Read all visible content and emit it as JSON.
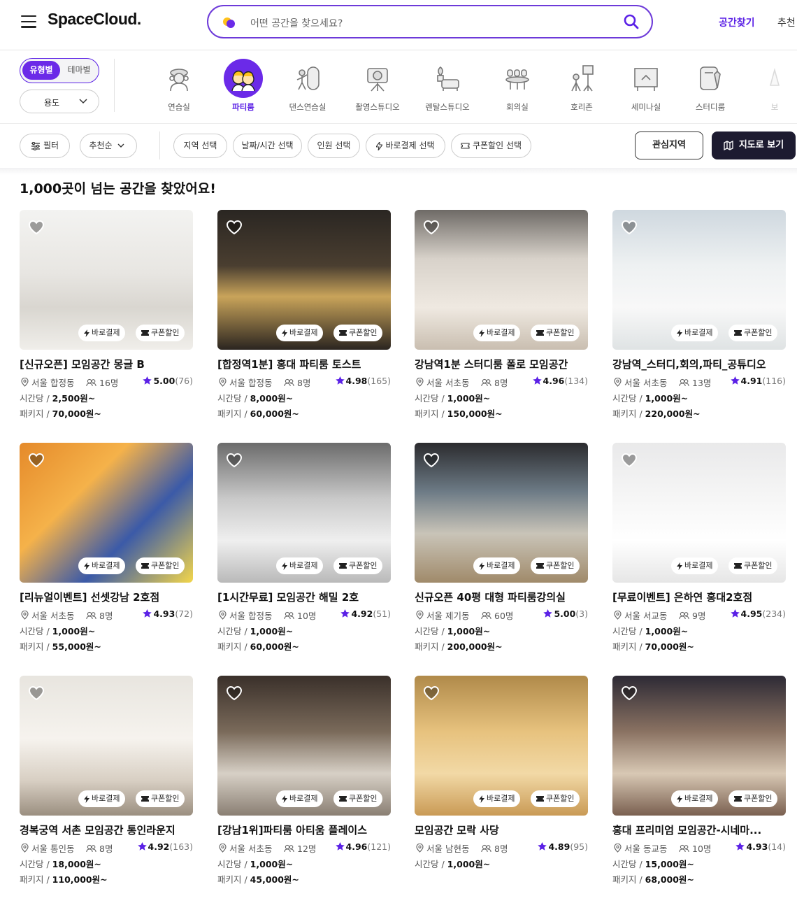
{
  "header": {
    "logo": "SpaceCloud.",
    "search_placeholder": "어떤 공간을 찾으세요?",
    "nav_find": "공간찾기",
    "nav_recommend": "추천"
  },
  "type_toggle": {
    "type": "유형별",
    "theme": "테마별",
    "usage": "용도"
  },
  "categories": [
    {
      "label": "연습실",
      "icon": "practice-room-icon"
    },
    {
      "label": "파티룸",
      "icon": "party-room-icon",
      "active": true
    },
    {
      "label": "댄스연습실",
      "icon": "dance-room-icon"
    },
    {
      "label": "촬영스튜디오",
      "icon": "camera-studio-icon"
    },
    {
      "label": "렌탈스튜디오",
      "icon": "rental-studio-icon"
    },
    {
      "label": "회의실",
      "icon": "meeting-room-icon"
    },
    {
      "label": "호리존",
      "icon": "horizon-icon"
    },
    {
      "label": "세미나실",
      "icon": "seminar-room-icon"
    },
    {
      "label": "스터디룸",
      "icon": "study-room-icon"
    },
    {
      "label": "보",
      "icon": "more-icon"
    }
  ],
  "filters": {
    "filter": "필터",
    "sort": "추천순",
    "region": "지역 선택",
    "datetime": "날짜/시간 선택",
    "people": "인원 선택",
    "instant": "바로결제 선택",
    "coupon": "쿠폰할인 선택",
    "interest": "관심지역",
    "map": "지도로 보기"
  },
  "result_title": "1,000곳이 넘는 공간을 찾았어요!",
  "badges": {
    "instant": "바로결제",
    "coupon": "쿠폰할인"
  },
  "price_labels": {
    "hour": "시간당 /",
    "package": "패키지 /"
  },
  "listings": [
    {
      "title": "[신규오픈] 모임공간 몽글 B",
      "location": "서울 합정동",
      "capacity": "16명",
      "rating": "5.00",
      "reviews": "(76)",
      "hourly": "2,500원~",
      "package": "70,000원~"
    },
    {
      "title": "[합정역1분] 홍대 파티룸 토스트",
      "location": "서울 합정동",
      "capacity": "8명",
      "rating": "4.98",
      "reviews": "(165)",
      "hourly": "8,000원~",
      "package": "60,000원~"
    },
    {
      "title": "강남역1분 스터디룸 폴로 모임공간",
      "location": "서울 서초동",
      "capacity": "8명",
      "rating": "4.96",
      "reviews": "(134)",
      "hourly": "1,000원~",
      "package": "150,000원~"
    },
    {
      "title": "강남역_스터디,회의,파티_공튜디오",
      "location": "서울 서초동",
      "capacity": "13명",
      "rating": "4.91",
      "reviews": "(116)",
      "hourly": "1,000원~",
      "package": "220,000원~"
    },
    {
      "title": "[리뉴얼이벤트] 선셋강남 2호점",
      "location": "서울 서초동",
      "capacity": "8명",
      "rating": "4.93",
      "reviews": "(72)",
      "hourly": "1,000원~",
      "package": "55,000원~"
    },
    {
      "title": "[1시간무료] 모임공간 해밀 2호",
      "location": "서울 합정동",
      "capacity": "10명",
      "rating": "4.92",
      "reviews": "(51)",
      "hourly": "1,000원~",
      "package": "60,000원~"
    },
    {
      "title": "신규오픈 40평 대형 파티룸강의실",
      "location": "서울 제기동",
      "capacity": "60명",
      "rating": "5.00",
      "reviews": "(3)",
      "hourly": "1,000원~",
      "package": "200,000원~"
    },
    {
      "title": "[무료이벤트] 은하연 홍대2호점",
      "location": "서울 서교동",
      "capacity": "9명",
      "rating": "4.95",
      "reviews": "(234)",
      "hourly": "1,000원~",
      "package": "70,000원~"
    },
    {
      "title": "경복궁역 서촌 모임공간 통인라운지",
      "location": "서울 통인동",
      "capacity": "8명",
      "rating": "4.92",
      "reviews": "(163)",
      "hourly": "18,000원~",
      "package": "110,000원~"
    },
    {
      "title": "[강남1위]파티룸 아티움 플레이스",
      "location": "서울 서초동",
      "capacity": "12명",
      "rating": "4.96",
      "reviews": "(121)",
      "hourly": "1,000원~",
      "package": "45,000원~"
    },
    {
      "title": "모임공간 모락 사당",
      "location": "서울 남현동",
      "capacity": "8명",
      "rating": "4.89",
      "reviews": "(95)",
      "hourly": "1,000원~",
      "package": ""
    },
    {
      "title": "홍대 프리미엄 모임공간-시네마...",
      "location": "서울 동교동",
      "capacity": "10명",
      "rating": "4.93",
      "reviews": "(14)",
      "hourly": "15,000원~",
      "package": "68,000원~"
    }
  ],
  "colors": {
    "accent": "#6b2ae8",
    "accent_text": "#5b21e6",
    "map_button": "#1d1b30",
    "star": "#5b21e6"
  }
}
